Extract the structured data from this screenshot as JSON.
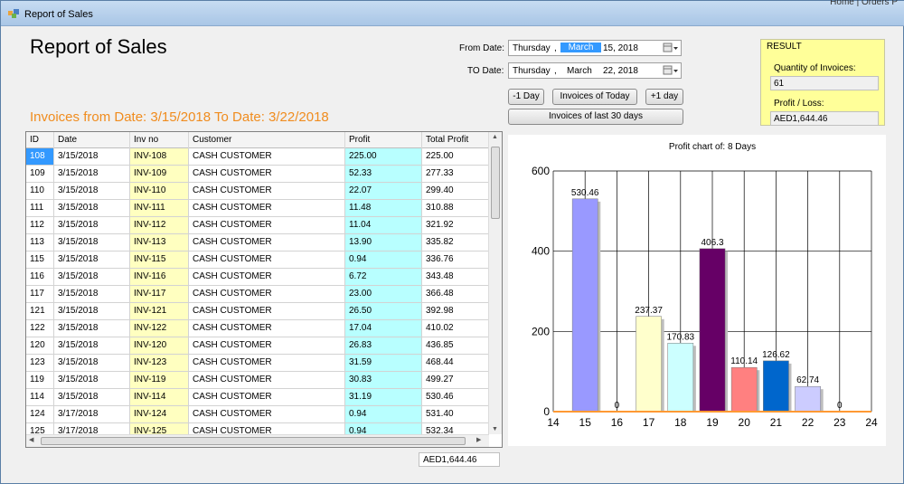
{
  "window": {
    "title": "Report of Sales",
    "corner_text": "Home | Orders P"
  },
  "page": {
    "title": "Report of Sales",
    "range_title": "Invoices from Date: 3/15/2018  To Date: 3/22/2018"
  },
  "filters": {
    "from_label": "From Date:",
    "to_label": "TO Date:",
    "from": {
      "weekday": "Thursday",
      "sep": ",",
      "month": "March",
      "day_year": "15, 2018"
    },
    "to": {
      "weekday": "Thursday",
      "sep": ",",
      "month": "March",
      "day_year": "22, 2018"
    }
  },
  "buttons": {
    "minus_day": "-1 Day",
    "today": "Invoices of Today",
    "plus_day": "+1 day",
    "last30": "Invoices of last 30 days"
  },
  "result": {
    "legend": "RESULT",
    "qty_label": "Quantity of Invoices:",
    "qty_value": "61",
    "profit_label": "Profit / Loss:",
    "profit_value": "AED1,644.46"
  },
  "grid": {
    "columns": [
      "ID",
      "Date",
      "Inv no",
      "Customer",
      "Profit",
      "Total Profit"
    ],
    "rows": [
      [
        "108",
        "3/15/2018",
        "INV-108",
        "CASH CUSTOMER",
        "225.00",
        "225.00"
      ],
      [
        "109",
        "3/15/2018",
        "INV-109",
        "CASH CUSTOMER",
        "52.33",
        "277.33"
      ],
      [
        "110",
        "3/15/2018",
        "INV-110",
        "CASH CUSTOMER",
        "22.07",
        "299.40"
      ],
      [
        "111",
        "3/15/2018",
        "INV-111",
        "CASH CUSTOMER",
        "11.48",
        "310.88"
      ],
      [
        "112",
        "3/15/2018",
        "INV-112",
        "CASH CUSTOMER",
        "11.04",
        "321.92"
      ],
      [
        "113",
        "3/15/2018",
        "INV-113",
        "CASH CUSTOMER",
        "13.90",
        "335.82"
      ],
      [
        "115",
        "3/15/2018",
        "INV-115",
        "CASH CUSTOMER",
        "0.94",
        "336.76"
      ],
      [
        "116",
        "3/15/2018",
        "INV-116",
        "CASH CUSTOMER",
        "6.72",
        "343.48"
      ],
      [
        "117",
        "3/15/2018",
        "INV-117",
        "CASH CUSTOMER",
        "23.00",
        "366.48"
      ],
      [
        "121",
        "3/15/2018",
        "INV-121",
        "CASH CUSTOMER",
        "26.50",
        "392.98"
      ],
      [
        "122",
        "3/15/2018",
        "INV-122",
        "CASH CUSTOMER",
        "17.04",
        "410.02"
      ],
      [
        "120",
        "3/15/2018",
        "INV-120",
        "CASH CUSTOMER",
        "26.83",
        "436.85"
      ],
      [
        "123",
        "3/15/2018",
        "INV-123",
        "CASH CUSTOMER",
        "31.59",
        "468.44"
      ],
      [
        "119",
        "3/15/2018",
        "INV-119",
        "CASH CUSTOMER",
        "30.83",
        "499.27"
      ],
      [
        "114",
        "3/15/2018",
        "INV-114",
        "CASH CUSTOMER",
        "31.19",
        "530.46"
      ],
      [
        "124",
        "3/17/2018",
        "INV-124",
        "CASH CUSTOMER",
        "0.94",
        "531.40"
      ],
      [
        "125",
        "3/17/2018",
        "INV-125",
        "CASH CUSTOMER",
        "0.94",
        "532.34"
      ]
    ],
    "total": "AED1,644.46"
  },
  "chart_data": {
    "type": "bar",
    "title": "Profit chart of: 8 Days",
    "categories": [
      "15",
      "16",
      "17",
      "18",
      "19",
      "20",
      "21",
      "22",
      "23"
    ],
    "values": [
      530.46,
      0,
      237.37,
      170.83,
      406.3,
      110.14,
      126.62,
      62.74,
      0
    ],
    "data_labels": [
      "530.46",
      "0",
      "237.37",
      "170.83",
      "406.3",
      "110.14",
      "126.62",
      "62.74",
      "0"
    ],
    "colors": [
      "#9999ff",
      "#993366",
      "#ffffcc",
      "#ccffff",
      "#660066",
      "#ff8080",
      "#0066cc",
      "#ccccff",
      "#000080"
    ],
    "x_ticks": [
      "14",
      "15",
      "16",
      "17",
      "18",
      "19",
      "20",
      "21",
      "22",
      "23",
      "24"
    ],
    "y_ticks": [
      "0",
      "200",
      "400",
      "600"
    ],
    "ylim": [
      0,
      600
    ],
    "xlim": [
      14,
      24
    ],
    "grid": true
  }
}
